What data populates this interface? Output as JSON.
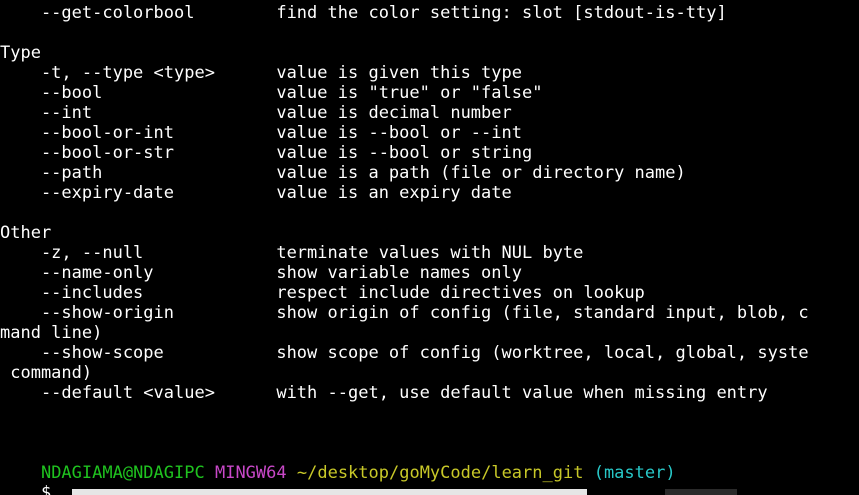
{
  "terminal": {
    "lines": [
      "    --get-colorbool        find the color setting: slot [stdout-is-tty]",
      "",
      "Type",
      "    -t, --type <type>      value is given this type",
      "    --bool                 value is \"true\" or \"false\"",
      "    --int                  value is decimal number",
      "    --bool-or-int          value is --bool or --int",
      "    --bool-or-str          value is --bool or string",
      "    --path                 value is a path (file or directory name)",
      "    --expiry-date          value is an expiry date",
      "",
      "Other",
      "    -z, --null             terminate values with NUL byte",
      "    --name-only            show variable names only",
      "    --includes             respect include directives on lookup",
      "    --show-origin          show origin of config (file, standard input, blob, c",
      "mand line)",
      "    --show-scope           show scope of config (worktree, local, global, syste",
      " command)",
      "    --default <value>      with --get, use default value when missing entry",
      "",
      ""
    ],
    "prompt": {
      "user_host": "NDAGIAMA@NDAGIPC",
      "system": "MINGW64",
      "path": "~/desktop/goMyCode/learn_git",
      "branch": "(master)",
      "symbol": "$"
    },
    "colors": {
      "background": "#000000",
      "text": "#ffffff",
      "user_host": "#1fc21f",
      "system": "#c848c8",
      "path": "#c8c828",
      "branch": "#28c8c8"
    }
  }
}
